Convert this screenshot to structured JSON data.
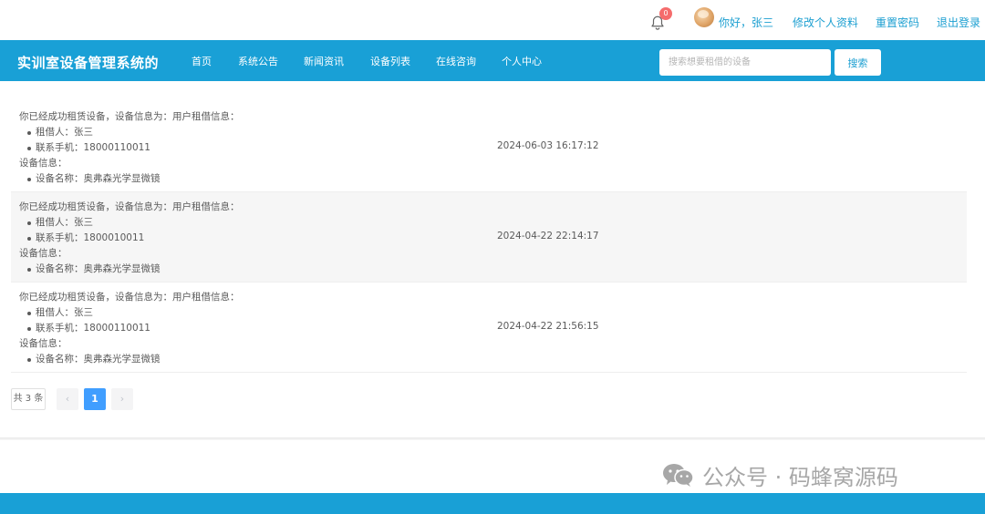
{
  "topbar": {
    "notification_count": "0",
    "greeting": "你好，张三",
    "edit_profile": "修改个人资料",
    "reset_password": "重置密码",
    "logout": "退出登录"
  },
  "navbar": {
    "brand": "实训室设备管理系统的",
    "items": [
      "首页",
      "系统公告",
      "新闻资讯",
      "设备列表",
      "在线咨询",
      "个人中心"
    ],
    "search_placeholder": "搜索想要租借的设备",
    "search_button": "搜索"
  },
  "records": [
    {
      "headline": "你已经成功租赁设备，设备信息为：用户租借信息：",
      "borrower": "租借人：张三",
      "phone": "联系手机：18000110011",
      "device_header": "设备信息：",
      "device_name": "设备名称：奥弗森光学显微镜",
      "time": "2024-06-03 16:17:12"
    },
    {
      "headline": "你已经成功租赁设备，设备信息为：用户租借信息：",
      "borrower": "租借人：张三",
      "phone": "联系手机：1800010011",
      "device_header": "设备信息：",
      "device_name": "设备名称：奥弗森光学显微镜",
      "time": "2024-04-22 22:14:17"
    },
    {
      "headline": "你已经成功租赁设备，设备信息为：用户租借信息：",
      "borrower": "租借人：张三",
      "phone": "联系手机：18000110011",
      "device_header": "设备信息：",
      "device_name": "设备名称：奥弗森光学显微镜",
      "time": "2024-04-22 21:56:15"
    }
  ],
  "pagination": {
    "total": "共 3 条",
    "prev": "‹",
    "current": "1",
    "next": "›"
  },
  "watermark": "公众号 · 码蜂窝源码",
  "icons": {
    "bell": "bell-icon",
    "avatar": "avatar",
    "wechat": "wechat-icon"
  },
  "colors": {
    "brand_blue": "#19a0d6",
    "link_blue": "#1c9fd1",
    "active_page": "#409eff",
    "badge_red": "#f56c6c"
  }
}
